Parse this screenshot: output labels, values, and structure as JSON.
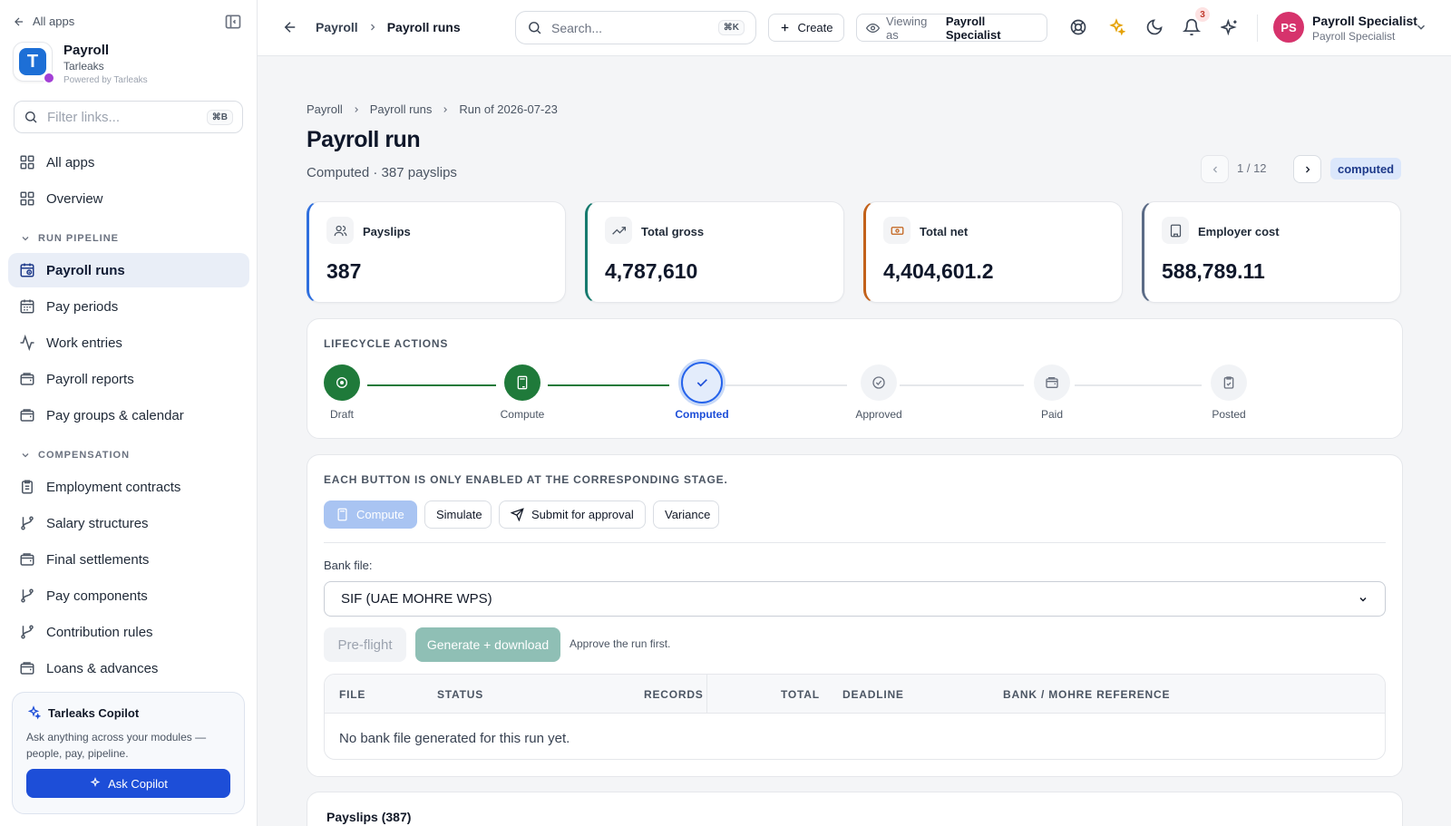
{
  "sidebar": {
    "all_apps": "All apps",
    "brand_title": "Payroll",
    "brand_org": "Tarleaks",
    "brand_powered": "Powered by Tarleaks",
    "brand_letter": "T",
    "filter_placeholder": "Filter links...",
    "filter_kbd": "⌘B",
    "top_items": [
      {
        "label": "All apps",
        "icon": "grid-icon"
      },
      {
        "label": "Overview",
        "icon": "grid-icon"
      }
    ],
    "sections": [
      {
        "label": "RUN PIPELINE",
        "items": [
          {
            "label": "Payroll runs",
            "icon": "calendar-clock-icon",
            "active": true
          },
          {
            "label": "Pay periods",
            "icon": "calendar-icon"
          },
          {
            "label": "Work entries",
            "icon": "activity-icon"
          },
          {
            "label": "Payroll reports",
            "icon": "wallet-icon"
          },
          {
            "label": "Pay groups & calendar",
            "icon": "wallet-icon"
          }
        ]
      },
      {
        "label": "COMPENSATION",
        "items": [
          {
            "label": "Employment contracts",
            "icon": "clipboard-icon"
          },
          {
            "label": "Salary structures",
            "icon": "git-branch-icon"
          },
          {
            "label": "Final settlements",
            "icon": "wallet-icon"
          },
          {
            "label": "Pay components",
            "icon": "git-branch-icon"
          },
          {
            "label": "Contribution rules",
            "icon": "git-branch-icon"
          },
          {
            "label": "Loans & advances",
            "icon": "wallet-icon"
          }
        ]
      }
    ],
    "copilot": {
      "title": "Tarleaks Copilot",
      "description": "Ask anything across your modules — people, pay, pipeline.",
      "button": "Ask Copilot"
    }
  },
  "topbar": {
    "crumb_parent": "Payroll",
    "crumb_current": "Payroll runs",
    "search_placeholder": "Search...",
    "search_kbd": "⌘K",
    "create_label": "Create",
    "viewing_label": "Viewing as",
    "viewing_value": "Payroll Specialist",
    "notification_count": "3",
    "user_initials": "PS",
    "user_name": "Payroll Specialist",
    "user_role": "Payroll Specialist"
  },
  "page": {
    "breadcrumb": [
      "Payroll",
      "Payroll runs",
      "Run of 2026-07-23"
    ],
    "title": "Payroll run",
    "subtitle": "Computed · 387 payslips",
    "pager": "1 / 12",
    "status": "computed"
  },
  "kpis": [
    {
      "label": "Payslips",
      "value": "387",
      "icon": "users-icon",
      "accent": "#2f6fde"
    },
    {
      "label": "Total gross",
      "value": "4,787,610",
      "icon": "trending-up-icon",
      "accent": "#167a6e"
    },
    {
      "label": "Total net",
      "value": "4,404,601.2",
      "icon": "banknote-icon",
      "accent": "#c2611a"
    },
    {
      "label": "Employer cost",
      "value": "588,789.11",
      "icon": "building-icon",
      "accent": "#5b6b86"
    }
  ],
  "lifecycle": {
    "title": "LIFECYCLE ACTIONS",
    "steps": [
      {
        "label": "Draft",
        "state": "done",
        "icon": "circle-dot-icon"
      },
      {
        "label": "Compute",
        "state": "done",
        "icon": "calculator-icon"
      },
      {
        "label": "Computed",
        "state": "current",
        "icon": "check-icon"
      },
      {
        "label": "Approved",
        "state": "todo",
        "icon": "check-circle-icon"
      },
      {
        "label": "Paid",
        "state": "todo",
        "icon": "wallet-icon"
      },
      {
        "label": "Posted",
        "state": "todo",
        "icon": "clipboard-check-icon"
      }
    ]
  },
  "actions": {
    "note": "EACH BUTTON IS ONLY ENABLED AT THE CORRESPONDING STAGE.",
    "buttons": {
      "compute": "Compute",
      "simulate": "Simulate",
      "submit": "Submit for approval",
      "variance": "Variance"
    },
    "bank_file_label": "Bank file:",
    "bank_file_value": "SIF (UAE MOHRE WPS)",
    "preflight": "Pre-flight",
    "generate": "Generate + download",
    "hint": "Approve the run first.",
    "table_headers": {
      "file": "FILE",
      "status": "STATUS",
      "records": "RECORDS",
      "total": "TOTAL",
      "deadline": "DEADLINE",
      "reference": "BANK / MOHRE REFERENCE"
    },
    "empty": "No bank file generated for this run yet."
  },
  "payslips_header": "Payslips (387)"
}
